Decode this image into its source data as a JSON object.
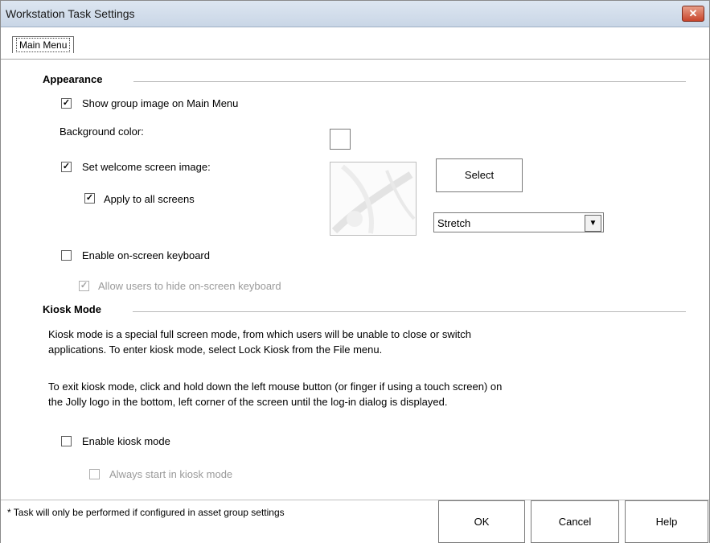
{
  "window": {
    "title": "Workstation Task Settings",
    "close_glyph": "✕"
  },
  "tabs": [
    {
      "label": "Main Menu"
    }
  ],
  "appearance": {
    "title": "Appearance",
    "show_group_image": {
      "label": "Show group image on Main Menu",
      "checked": true
    },
    "background_color_label": "Background color:",
    "background_color": "#ffffff",
    "welcome_image": {
      "label": "Set welcome screen image:",
      "checked": true
    },
    "apply_all": {
      "label": "Apply to all screens",
      "checked": true
    },
    "select_button": "Select",
    "stretch_option": "Stretch",
    "enable_keyboard": {
      "label": "Enable on-screen keyboard",
      "checked": false
    },
    "allow_hide_keyboard": {
      "label": "Allow users to hide on-screen keyboard",
      "checked": true,
      "disabled": true
    }
  },
  "kiosk": {
    "title": "Kiosk Mode",
    "para1_line1": "Kiosk mode is a special full screen mode, from which users will be unable to close or switch",
    "para1_line2": "applications. To enter kiosk mode, select Lock Kiosk from the File menu.",
    "para2_line1": "To exit kiosk mode, click and hold down the left mouse button (or finger if using a touch screen) on",
    "para2_line2": "the Jolly logo in the bottom, left corner of the screen until the log-in dialog is displayed.",
    "enable_kiosk": {
      "label": "Enable kiosk mode",
      "checked": false
    },
    "always_start": {
      "label": "Always start in kiosk mode",
      "checked": false,
      "disabled": true
    }
  },
  "footer": {
    "note": "* Task will only be performed if configured in asset group settings",
    "ok": "OK",
    "cancel": "Cancel",
    "help": "Help"
  },
  "icons": {
    "check": "✓",
    "dropdown": "▼"
  }
}
